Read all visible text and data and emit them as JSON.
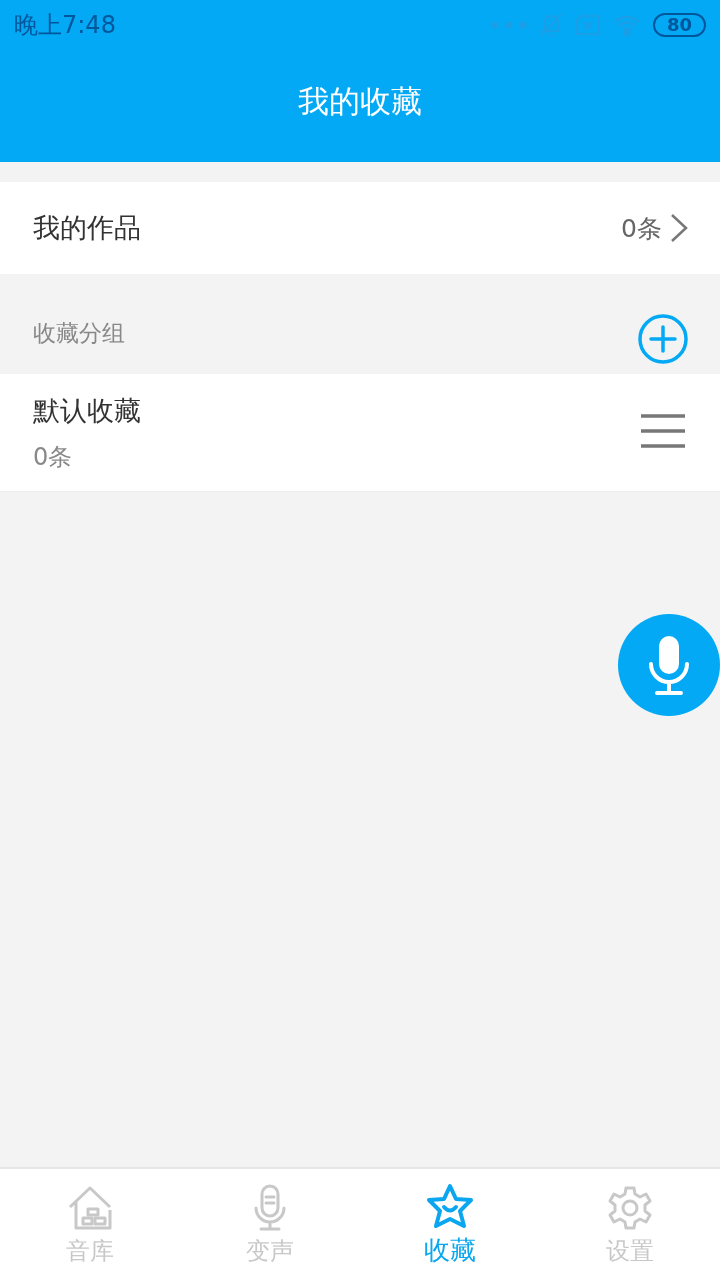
{
  "status_bar": {
    "time": "晚上7:48",
    "battery": "80"
  },
  "header": {
    "title": "我的收藏"
  },
  "my_works": {
    "label": "我的作品",
    "count": "0条"
  },
  "groups_section": {
    "label": "收藏分组"
  },
  "groups": [
    {
      "name": "默认收藏",
      "count": "0条"
    }
  ],
  "nav": [
    {
      "label": "音库",
      "selected": false
    },
    {
      "label": "变声",
      "selected": false
    },
    {
      "label": "收藏",
      "selected": true
    },
    {
      "label": "设置",
      "selected": false
    }
  ]
}
